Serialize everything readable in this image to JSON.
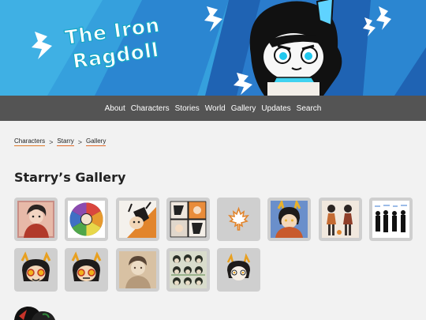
{
  "site": {
    "title_line1": "The Iron",
    "title_line2": "Ragdoll"
  },
  "nav": {
    "items": [
      {
        "label": "About"
      },
      {
        "label": "Characters"
      },
      {
        "label": "Stories"
      },
      {
        "label": "World"
      },
      {
        "label": "Gallery"
      },
      {
        "label": "Updates"
      },
      {
        "label": "Search"
      }
    ]
  },
  "breadcrumb": {
    "items": [
      {
        "label": "Characters"
      },
      {
        "label": "Starry"
      },
      {
        "label": "Gallery"
      }
    ],
    "separator": ">"
  },
  "page": {
    "title": "Starry’s Gallery"
  },
  "gallery": {
    "thumbnails": [
      {
        "subject": "starry-portrait-red-sweater"
      },
      {
        "subject": "color-wheel-faces"
      },
      {
        "subject": "orange-sun-sketch"
      },
      {
        "subject": "comic-panels"
      },
      {
        "subject": "maple-leaf-emblem"
      },
      {
        "subject": "antlered-starry-blue-bg"
      },
      {
        "subject": "reference-sheet"
      },
      {
        "subject": "silhouette-lineup"
      },
      {
        "subject": "starry-face-glowing-eyes"
      },
      {
        "subject": "starry-face-glowing-eyes-2"
      },
      {
        "subject": "sepia-sketch"
      },
      {
        "subject": "expression-collage"
      },
      {
        "subject": "starry-face-sketch"
      }
    ]
  },
  "colors": {
    "banner_blue": "#2f8fd8",
    "banner_dark_blue": "#1f63b3",
    "nav_bg": "#545454",
    "page_bg": "#f2f2f2",
    "thumb_bg": "#cfcfcf",
    "accent_orange": "#e2692a",
    "title_cyan": "#15a8c6"
  }
}
